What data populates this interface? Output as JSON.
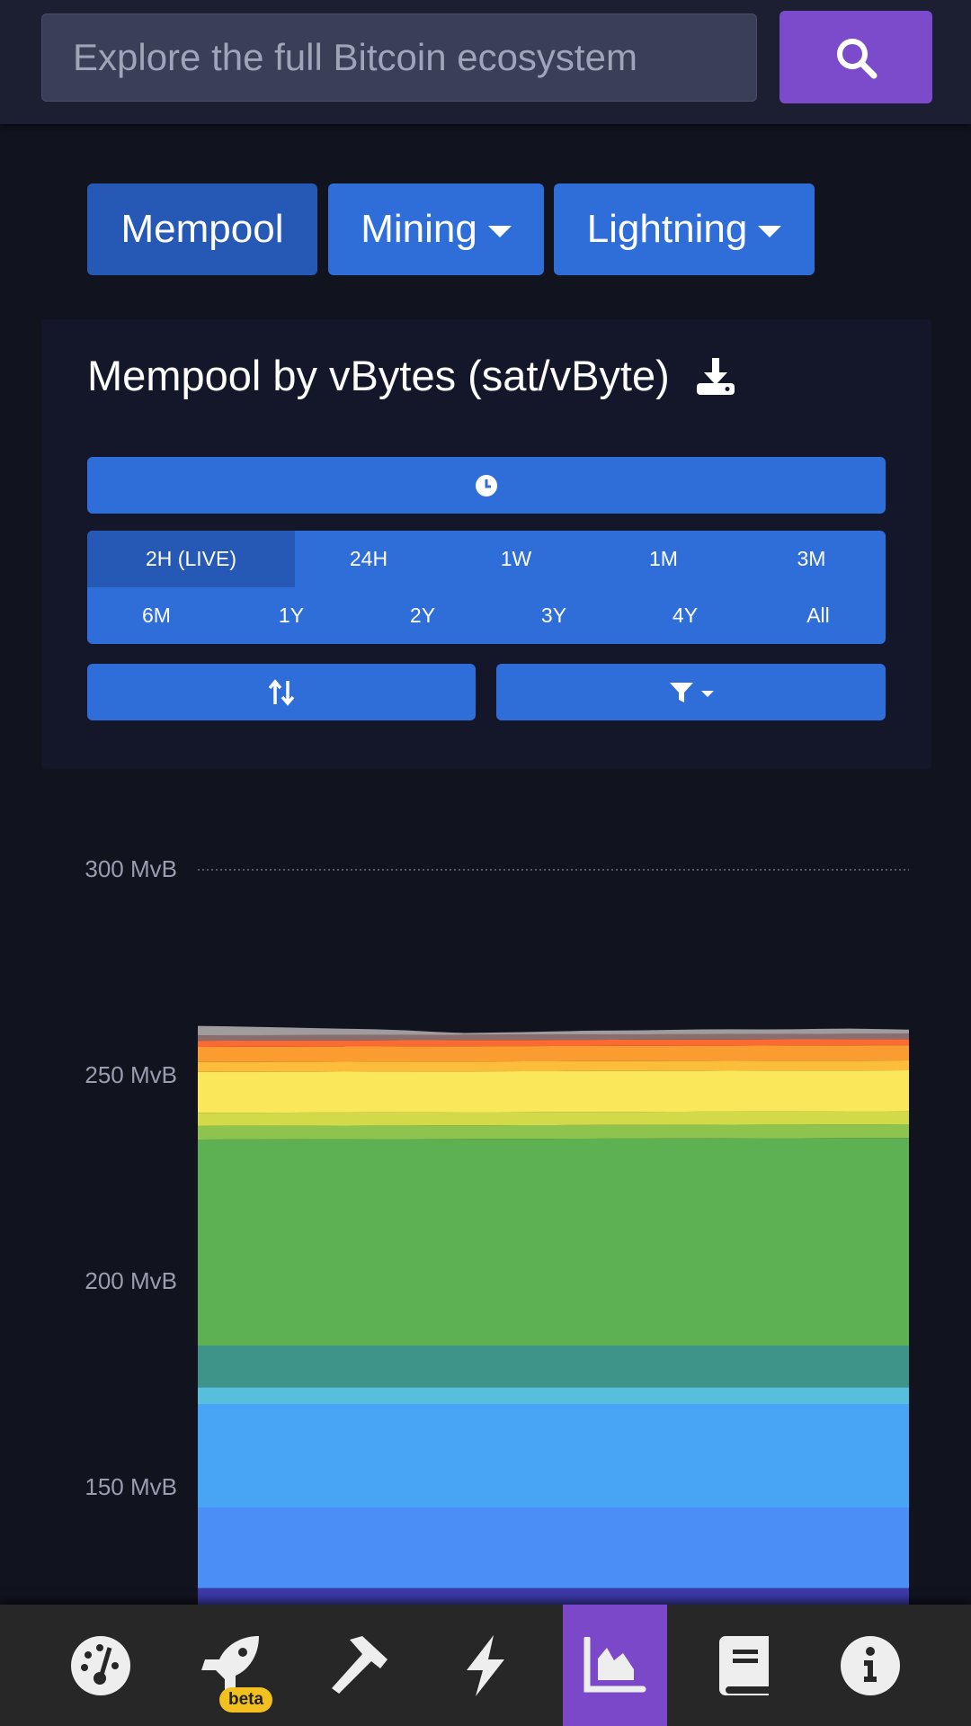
{
  "header": {
    "search_placeholder": "Explore the full Bitcoin ecosystem",
    "search_icon": "search-icon"
  },
  "nav": {
    "items": [
      {
        "label": "Mempool",
        "active": true
      },
      {
        "label": "Mining",
        "dropdown": true
      },
      {
        "label": "Lightning",
        "dropdown": true
      }
    ]
  },
  "graph": {
    "title": "Mempool by vBytes (sat/vByte)",
    "download_icon": "download-icon",
    "clock_icon": "clock-icon",
    "sort_icon": "sort-arrows-icon",
    "filter_icon": "filter-icon"
  },
  "ranges": {
    "row1": [
      "2H (LIVE)",
      "24H",
      "1W",
      "1M",
      "3M"
    ],
    "row2": [
      "6M",
      "1Y",
      "2Y",
      "3Y",
      "4Y",
      "All"
    ],
    "selected": "2H (LIVE)"
  },
  "colors": {
    "button": "#2f6ed9",
    "active_button": "#2559b5",
    "search_button": "#7c4bcb",
    "active_tab": "#7b48c9",
    "beta_badge": "#f3c11f"
  },
  "chart_data": {
    "type": "area",
    "stacked": true,
    "yunit": "MvB",
    "yticks": [
      "300 MvB",
      "250 MvB",
      "200 MvB",
      "150 MvB"
    ],
    "ytick_values": [
      300,
      250,
      200,
      150
    ],
    "grid": "dotted line at 300 MvB",
    "series": [
      {
        "color": "#3b3aa8",
        "values": [
          125.6,
          125.6
        ]
      },
      {
        "color": "#4a8ef6",
        "values": [
          19.6,
          19.6
        ]
      },
      {
        "color": "#48a5f5",
        "values": [
          25.1,
          25.1
        ]
      },
      {
        "color": "#57bfdc",
        "values": [
          4.1,
          4.1
        ]
      },
      {
        "color": "#3e9488",
        "values": [
          10.1,
          10.1
        ]
      },
      {
        "color": "#5eb152",
        "values": [
          50.0,
          50.4
        ]
      },
      {
        "color": "#8ec44e",
        "values": [
          3.3,
          3.3
        ]
      },
      {
        "color": "#d3da4a",
        "values": [
          3.2,
          3.2
        ]
      },
      {
        "color": "#fbe85a",
        "values": [
          9.9,
          9.9
        ]
      },
      {
        "color": "#fbbd3a",
        "values": [
          2.4,
          2.4
        ]
      },
      {
        "color": "#fb9c30",
        "values": [
          3.7,
          3.7
        ]
      },
      {
        "color": "#fb6a33",
        "values": [
          1.5,
          1.5
        ]
      },
      {
        "color": "#8a6e6e",
        "values": [
          1.3,
          1.3
        ]
      },
      {
        "color": "#a09c9e",
        "values": [
          2.3,
          2.0,
          1.6,
          1.3,
          0.4,
          0.6,
          0.9,
          1.0,
          1.2,
          1.1,
          1.3,
          1.0
        ]
      }
    ]
  },
  "tabbar": {
    "items": [
      "gauge-icon",
      "rocket-icon",
      "hammer-icon",
      "bolt-icon",
      "chart-area-icon",
      "book-icon",
      "info-icon"
    ],
    "active": 4,
    "beta_label": "beta"
  }
}
